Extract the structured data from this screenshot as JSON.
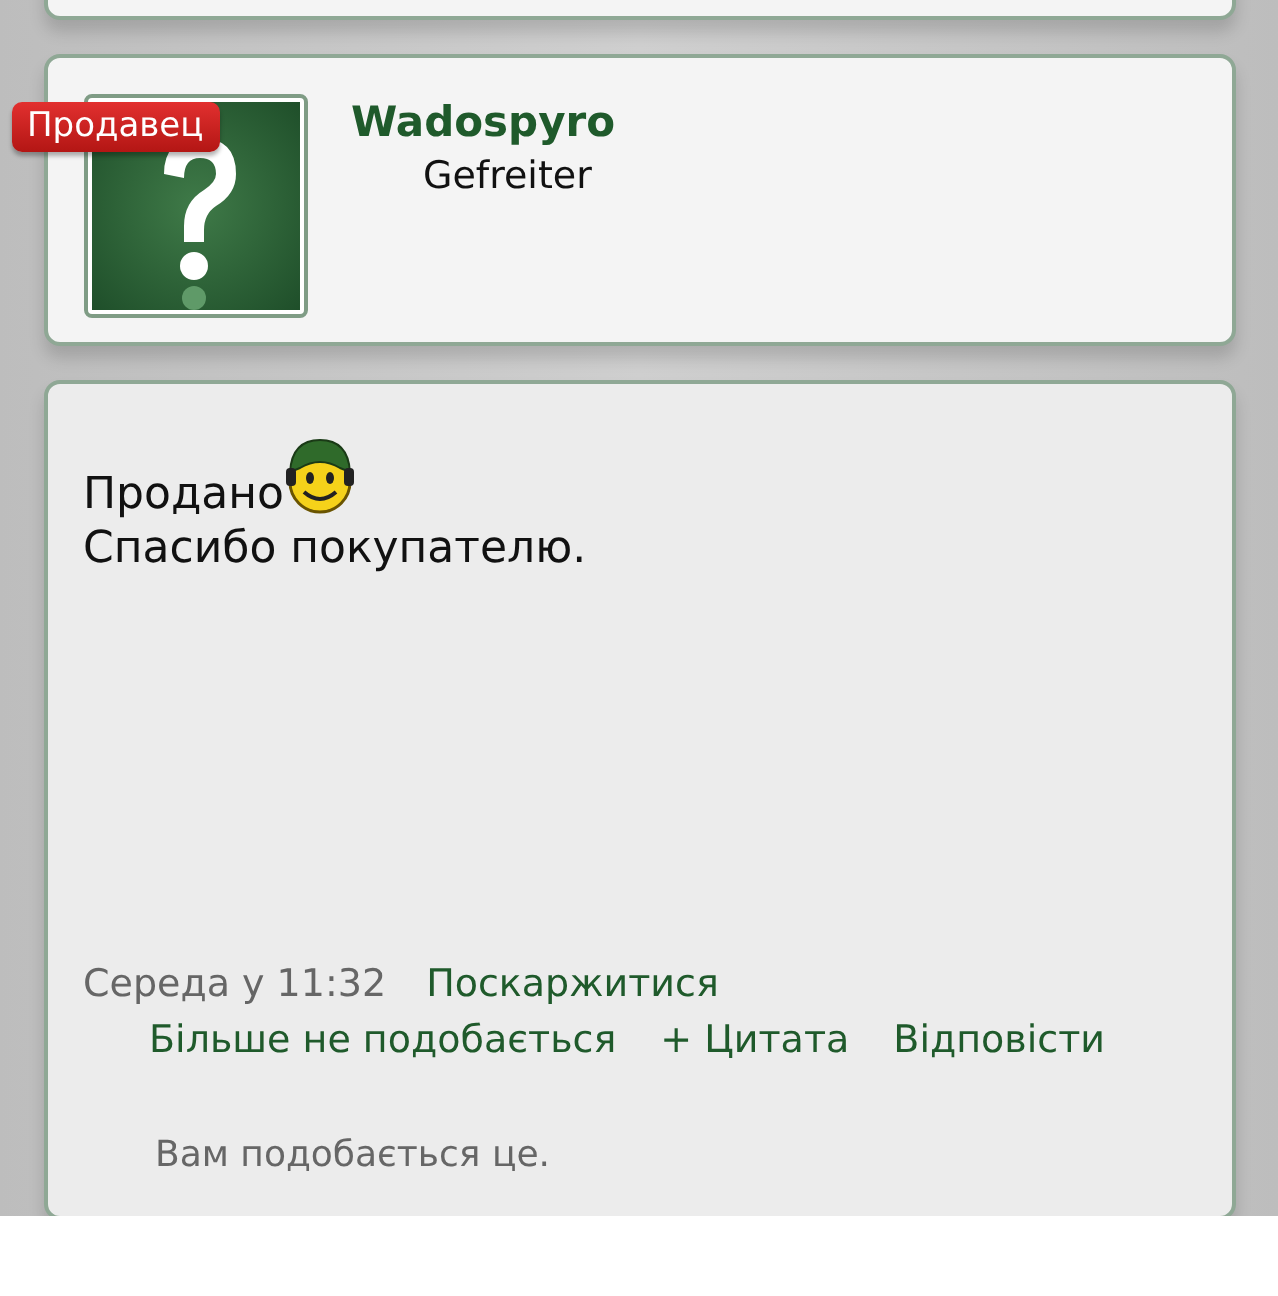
{
  "author": {
    "badge": "Продавец",
    "name": "Wadospyro",
    "rank": "Gefreiter"
  },
  "post": {
    "first_line": "Продано",
    "second_line": "Спасибо покупателю."
  },
  "meta": {
    "date": "Середа у 11:32",
    "report": "Поскаржитися"
  },
  "actions": [
    "Більше не подобається",
    "+ Цитата",
    "Відповісти"
  ],
  "likes": "Вам подобається це."
}
